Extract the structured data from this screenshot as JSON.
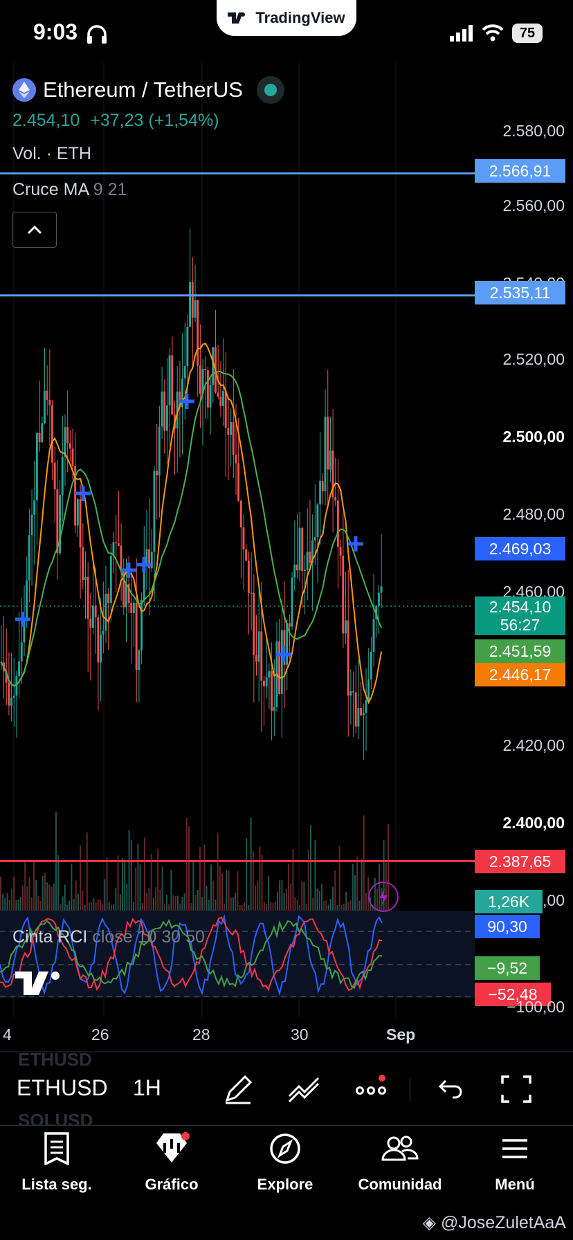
{
  "status_bar": {
    "time": "9:03",
    "battery": "75",
    "brand": "TradingView"
  },
  "symbol": {
    "name": "Ethereum / TetherUS",
    "price": "2.454,10",
    "change": "+37,23",
    "change_pct": "(+1,54%)",
    "volume_label": "Vol. · ETH",
    "indicator_name": "Cruce MA",
    "indicator_params": "9 21"
  },
  "price_axis": {
    "labels": [
      "2.580,00",
      "2.560,00",
      "2.540,00",
      "2.520,00",
      "2.500,00",
      "2.480,00",
      "2.460,00",
      "2.420,00",
      "2.400,00",
      "2.380,00"
    ],
    "tags": [
      {
        "text": "2.566,91",
        "color": "#5b9cf6"
      },
      {
        "text": "2.535,11",
        "color": "#5b9cf6"
      },
      {
        "text": "2.469,03",
        "color": "#2962ff"
      },
      {
        "text": "2.454,10",
        "sub": "56:27",
        "color": "#089981"
      },
      {
        "text": "2.451,59",
        "color": "#43a047"
      },
      {
        "text": "2.446,17",
        "color": "#f57c00"
      },
      {
        "text": "2.387,65",
        "color": "#f23645"
      },
      {
        "text": "1,26K",
        "color": "#26a69a"
      }
    ]
  },
  "rci": {
    "name": "Cinta RCI",
    "params": "close 10 30 50",
    "tags": [
      {
        "text": "90,30",
        "color": "#2962ff"
      },
      {
        "text": "−9,52",
        "color": "#43a047"
      },
      {
        "text": "−52,48",
        "color": "#f23645"
      }
    ],
    "axis_label": "−100,00"
  },
  "time_axis": [
    "4",
    "26",
    "28",
    "30",
    "Sep"
  ],
  "toolbar": {
    "symbol": "ETHUSD",
    "interval": "1H",
    "ghost_top": "ETHUSD",
    "ghost_bottom": "SOLUSD"
  },
  "nav": [
    {
      "label": "Lista seg.",
      "icon": "watchlist-icon"
    },
    {
      "label": "Gráfico",
      "icon": "chart-icon"
    },
    {
      "label": "Explore",
      "icon": "compass-icon"
    },
    {
      "label": "Comunidad",
      "icon": "community-icon"
    },
    {
      "label": "Menú",
      "icon": "menu-icon"
    }
  ],
  "watermark": "@JoseZuletAaA",
  "chart_data": {
    "type": "candlestick",
    "symbol": "ETHUSDT",
    "interval": "1H",
    "ylim": [
      2375,
      2590
    ],
    "x_ticks": [
      "4",
      "26",
      "28",
      "30",
      "Sep"
    ],
    "horizontal_lines": [
      2566.91,
      2535.11,
      2387.65
    ],
    "last_price": 2454.1,
    "ma_fast": 2451.59,
    "ma_slow": 2446.17,
    "close_path": [
      2440,
      2432,
      2455,
      2490,
      2520,
      2475,
      2500,
      2470,
      2455,
      2440,
      2470,
      2455,
      2445,
      2460,
      2495,
      2515,
      2500,
      2540,
      2510,
      2520,
      2500,
      2495,
      2465,
      2440,
      2430,
      2440,
      2460,
      2470,
      2465,
      2500,
      2470,
      2440,
      2420,
      2445,
      2455
    ],
    "rci": {
      "rci10": 90.3,
      "rci30": -9.52,
      "rci50": -52.48
    }
  }
}
